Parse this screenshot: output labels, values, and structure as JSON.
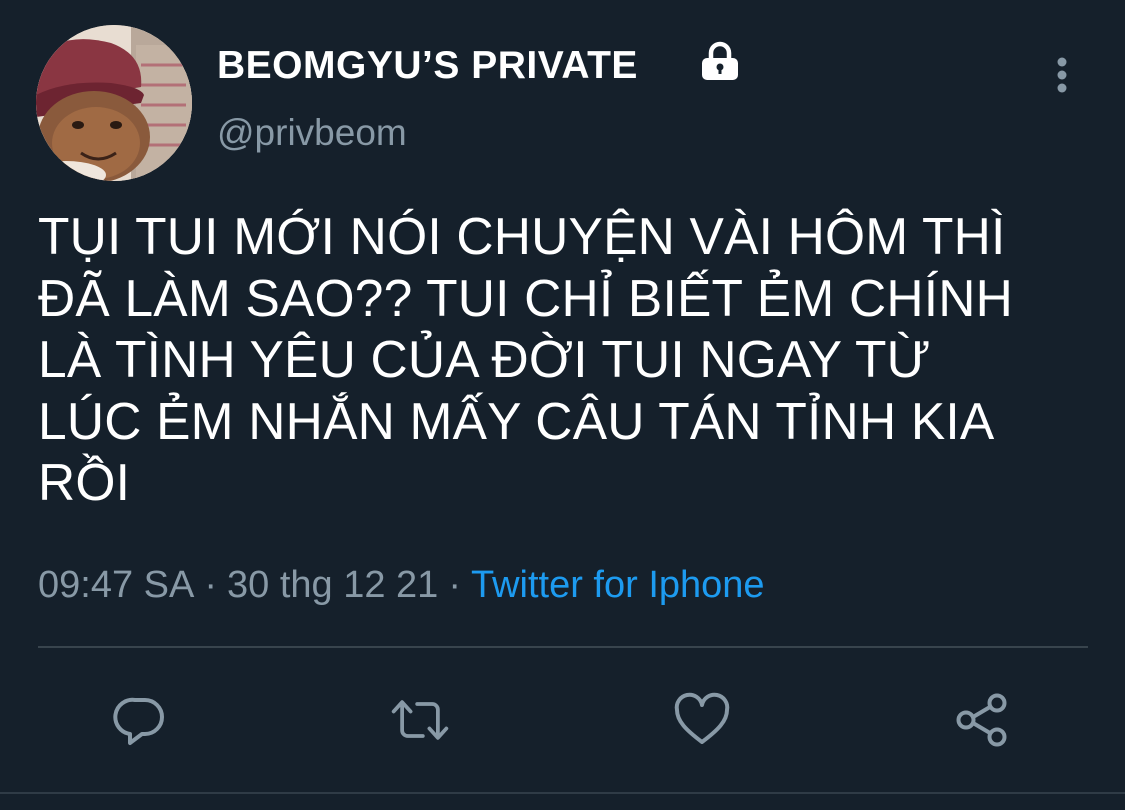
{
  "tweet": {
    "display_name": "BEOMGYU’S PRIVATE",
    "handle": "@privbeom",
    "protected_icon": "lock-icon",
    "avatar": "profile-photo",
    "text": "TỤI TUI MỚI NÓI CHUYỆN VÀI HÔM THÌ\nĐÃ LÀM SAO?? TUI CHỈ BIẾT ẺM CHÍNH\nLÀ TÌNH YÊU CỦA ĐỜI TUI NGAY TỪ\nLÚC ẺM NHẮN MẤY CÂU TÁN TỈNH KIA\nRỒI",
    "time": "09:47 SA",
    "date": "30 thg 12 21",
    "separator": "·",
    "source": "Twitter for Iphone"
  },
  "actions": {
    "reply": "reply-icon",
    "retweet": "retweet-icon",
    "like": "heart-icon",
    "share": "share-icon"
  },
  "colors": {
    "background": "#15202b",
    "text": "#ffffff",
    "muted": "#8899a6",
    "link": "#1d9bf0",
    "divider": "#38444d"
  }
}
